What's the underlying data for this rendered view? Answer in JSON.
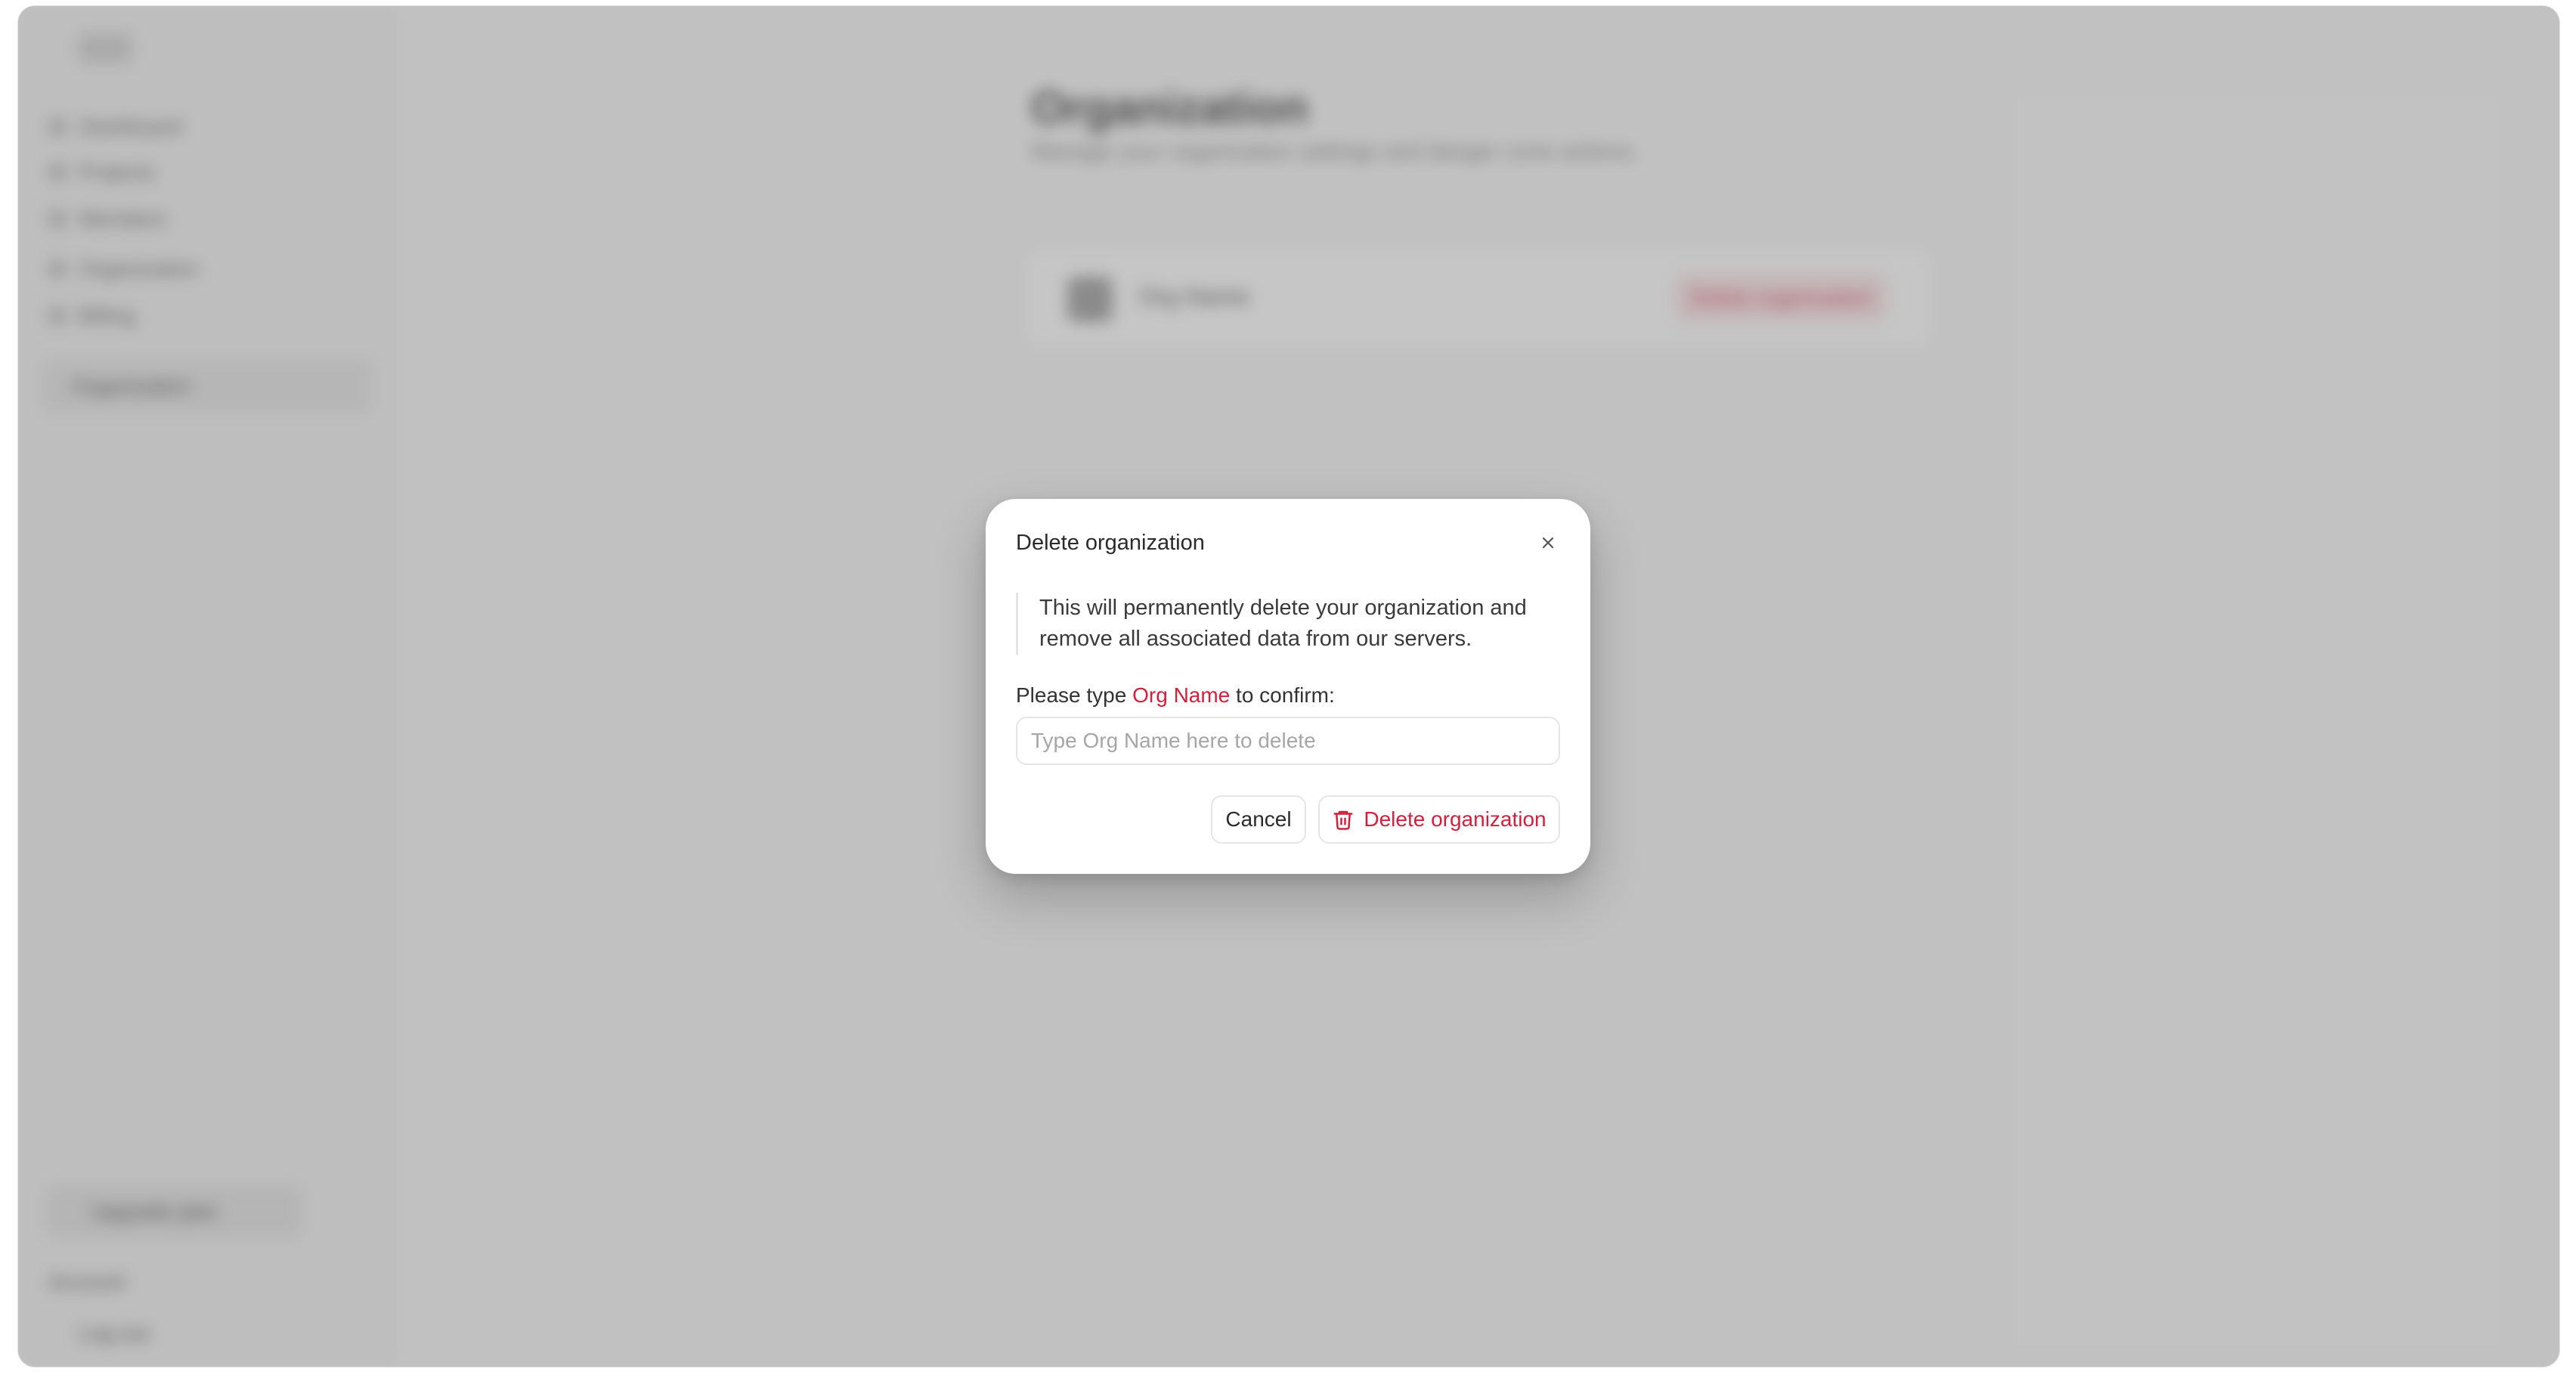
{
  "background": {
    "sidebar": {
      "items": [
        "Dashboard",
        "Projects",
        "Members",
        "Organization",
        "Billing"
      ],
      "org_select": "Organization",
      "cta": "Upgrade plan",
      "user": "Account",
      "logout": "Log out"
    },
    "main": {
      "title": "Organization",
      "subtitle": "Manage your organization settings and danger zone actions.",
      "org_name": "Org Name",
      "delete_button": "Delete organization"
    }
  },
  "modal": {
    "title": "Delete organization",
    "close_icon": "close-icon",
    "description": "This will permanently delete your organization and remove all associated data from our servers.",
    "confirm_prefix": "Please type",
    "confirm_org_name": "Org Name",
    "confirm_suffix": "to confirm:",
    "input_placeholder": "Type Org Name here to delete",
    "input_value": "",
    "cancel_label": "Cancel",
    "delete_label": "Delete organization",
    "delete_icon": "trash-icon"
  },
  "colors": {
    "danger": "#d21f3c",
    "overlay": "#787878"
  }
}
